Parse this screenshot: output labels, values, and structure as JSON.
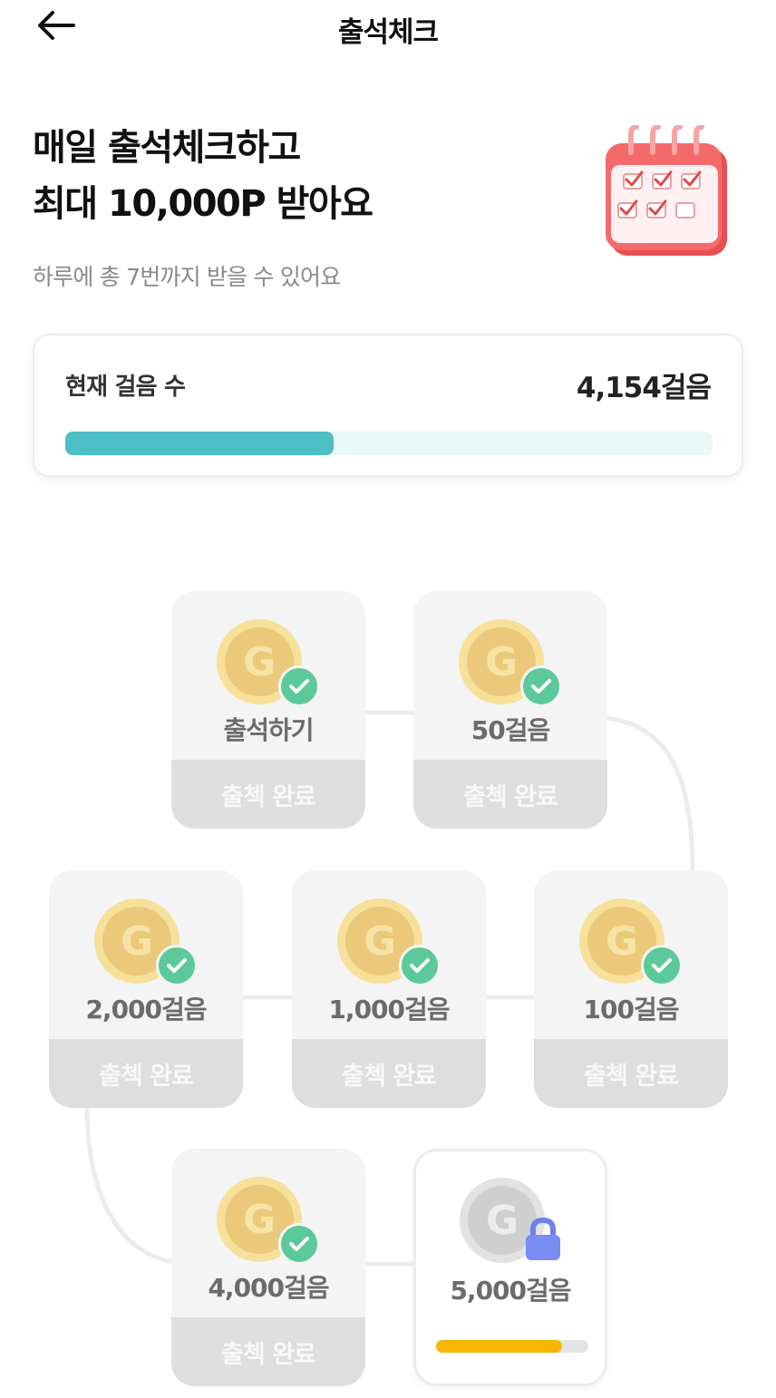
{
  "header": {
    "title": "출석체크",
    "back_icon": "arrow-left-icon"
  },
  "hero": {
    "title_line1": "매일 출석체크하고",
    "title_line2": "최대 10,000P 받아요",
    "subtitle": "하루에 총 7번까지 받을 수 있어요",
    "illustration_icon": "calendar-icon"
  },
  "steps": {
    "label": "현재 걸음 수",
    "value": "4,154걸음",
    "progress_fraction": 0.415,
    "fill_color": "#4bbfc4"
  },
  "missions": [
    {
      "label": "출석하기",
      "status": "출첵 완료",
      "state": "done"
    },
    {
      "label": "50걸음",
      "status": "출첵 완료",
      "state": "done"
    },
    {
      "label": "100걸음",
      "status": "출첵 완료",
      "state": "done"
    },
    {
      "label": "1,000걸음",
      "status": "출첵 완료",
      "state": "done"
    },
    {
      "label": "2,000걸음",
      "status": "출첵 완료",
      "state": "done"
    },
    {
      "label": "4,000걸음",
      "status": "출첵 완료",
      "state": "done"
    },
    {
      "label": "5,000걸음",
      "status": "",
      "state": "locked",
      "progress_fraction": 0.83
    }
  ],
  "colors": {
    "check_badge": "#5cc99a",
    "lock_badge": "#7b8cf5",
    "locked_progress": "#f7b500",
    "coin": "#f2d57e"
  }
}
